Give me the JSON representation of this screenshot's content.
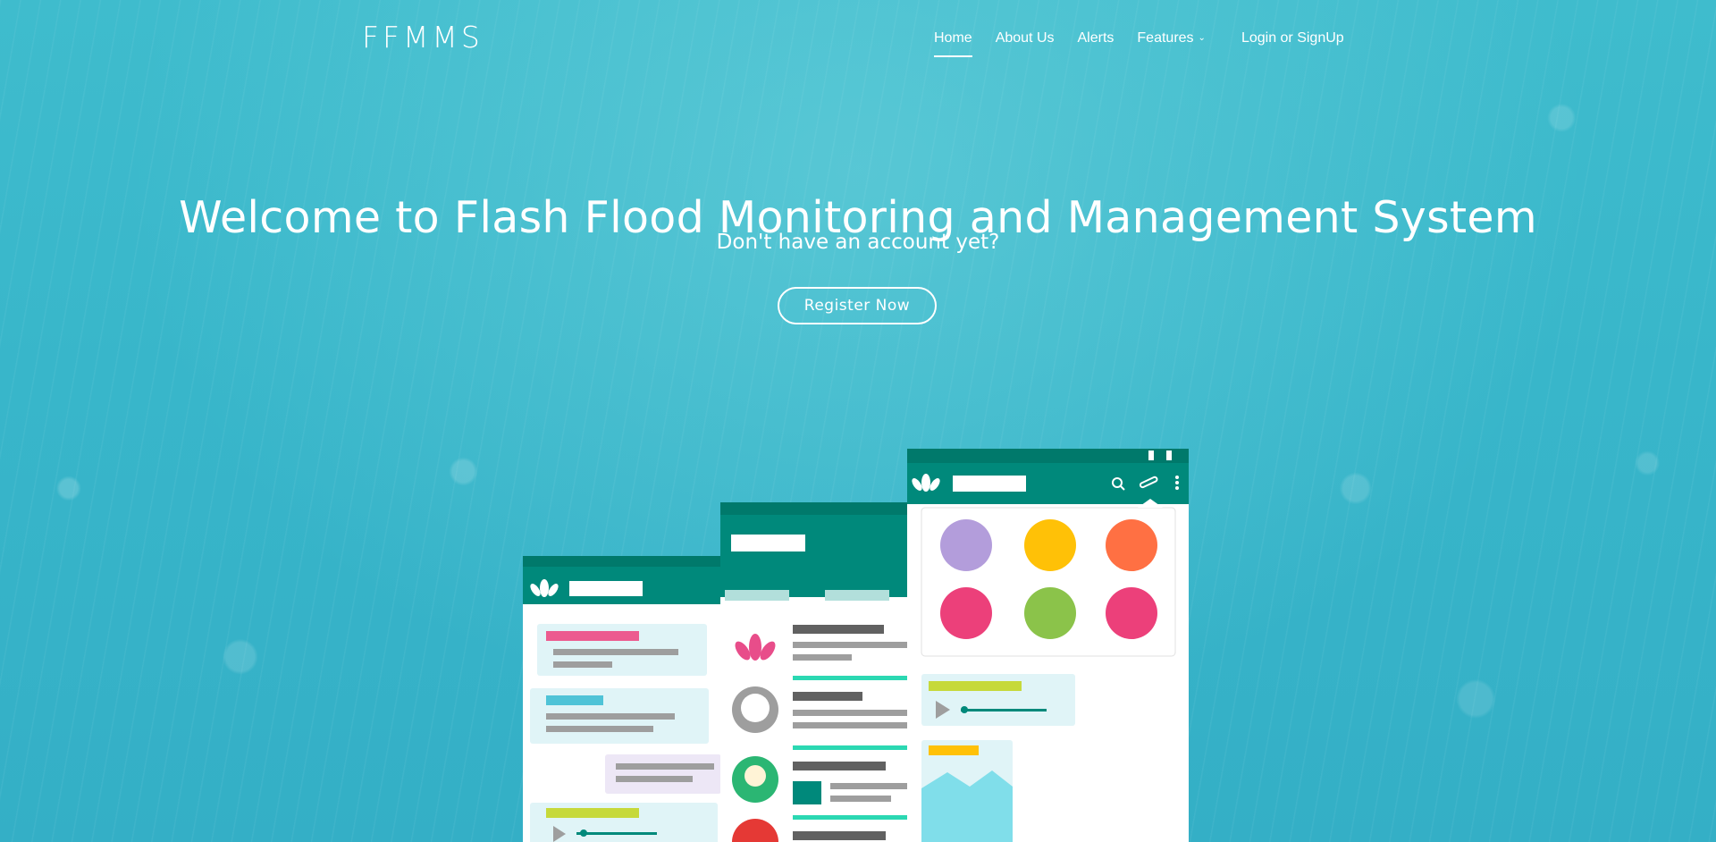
{
  "brand": {
    "logo_text": "FFMMS"
  },
  "nav": {
    "items": [
      {
        "label": "Home",
        "active": true
      },
      {
        "label": "About Us"
      },
      {
        "label": "Alerts"
      },
      {
        "label": "Features",
        "has_dropdown": true
      }
    ],
    "login_label": "Login or SignUp"
  },
  "hero": {
    "title": "Welcome to Flash Flood Monitoring and Management System",
    "subtitle": "Don't have an account yet?",
    "cta_label": "Register Now"
  },
  "illustration": {
    "name": "messaging-app-phones-illustration",
    "colors": {
      "teal": "#00897b",
      "teal_dark": "#00796b",
      "bubble": "#e0f4f7"
    }
  },
  "theme": {
    "background": "#3bb8cb",
    "text": "#ffffff"
  }
}
